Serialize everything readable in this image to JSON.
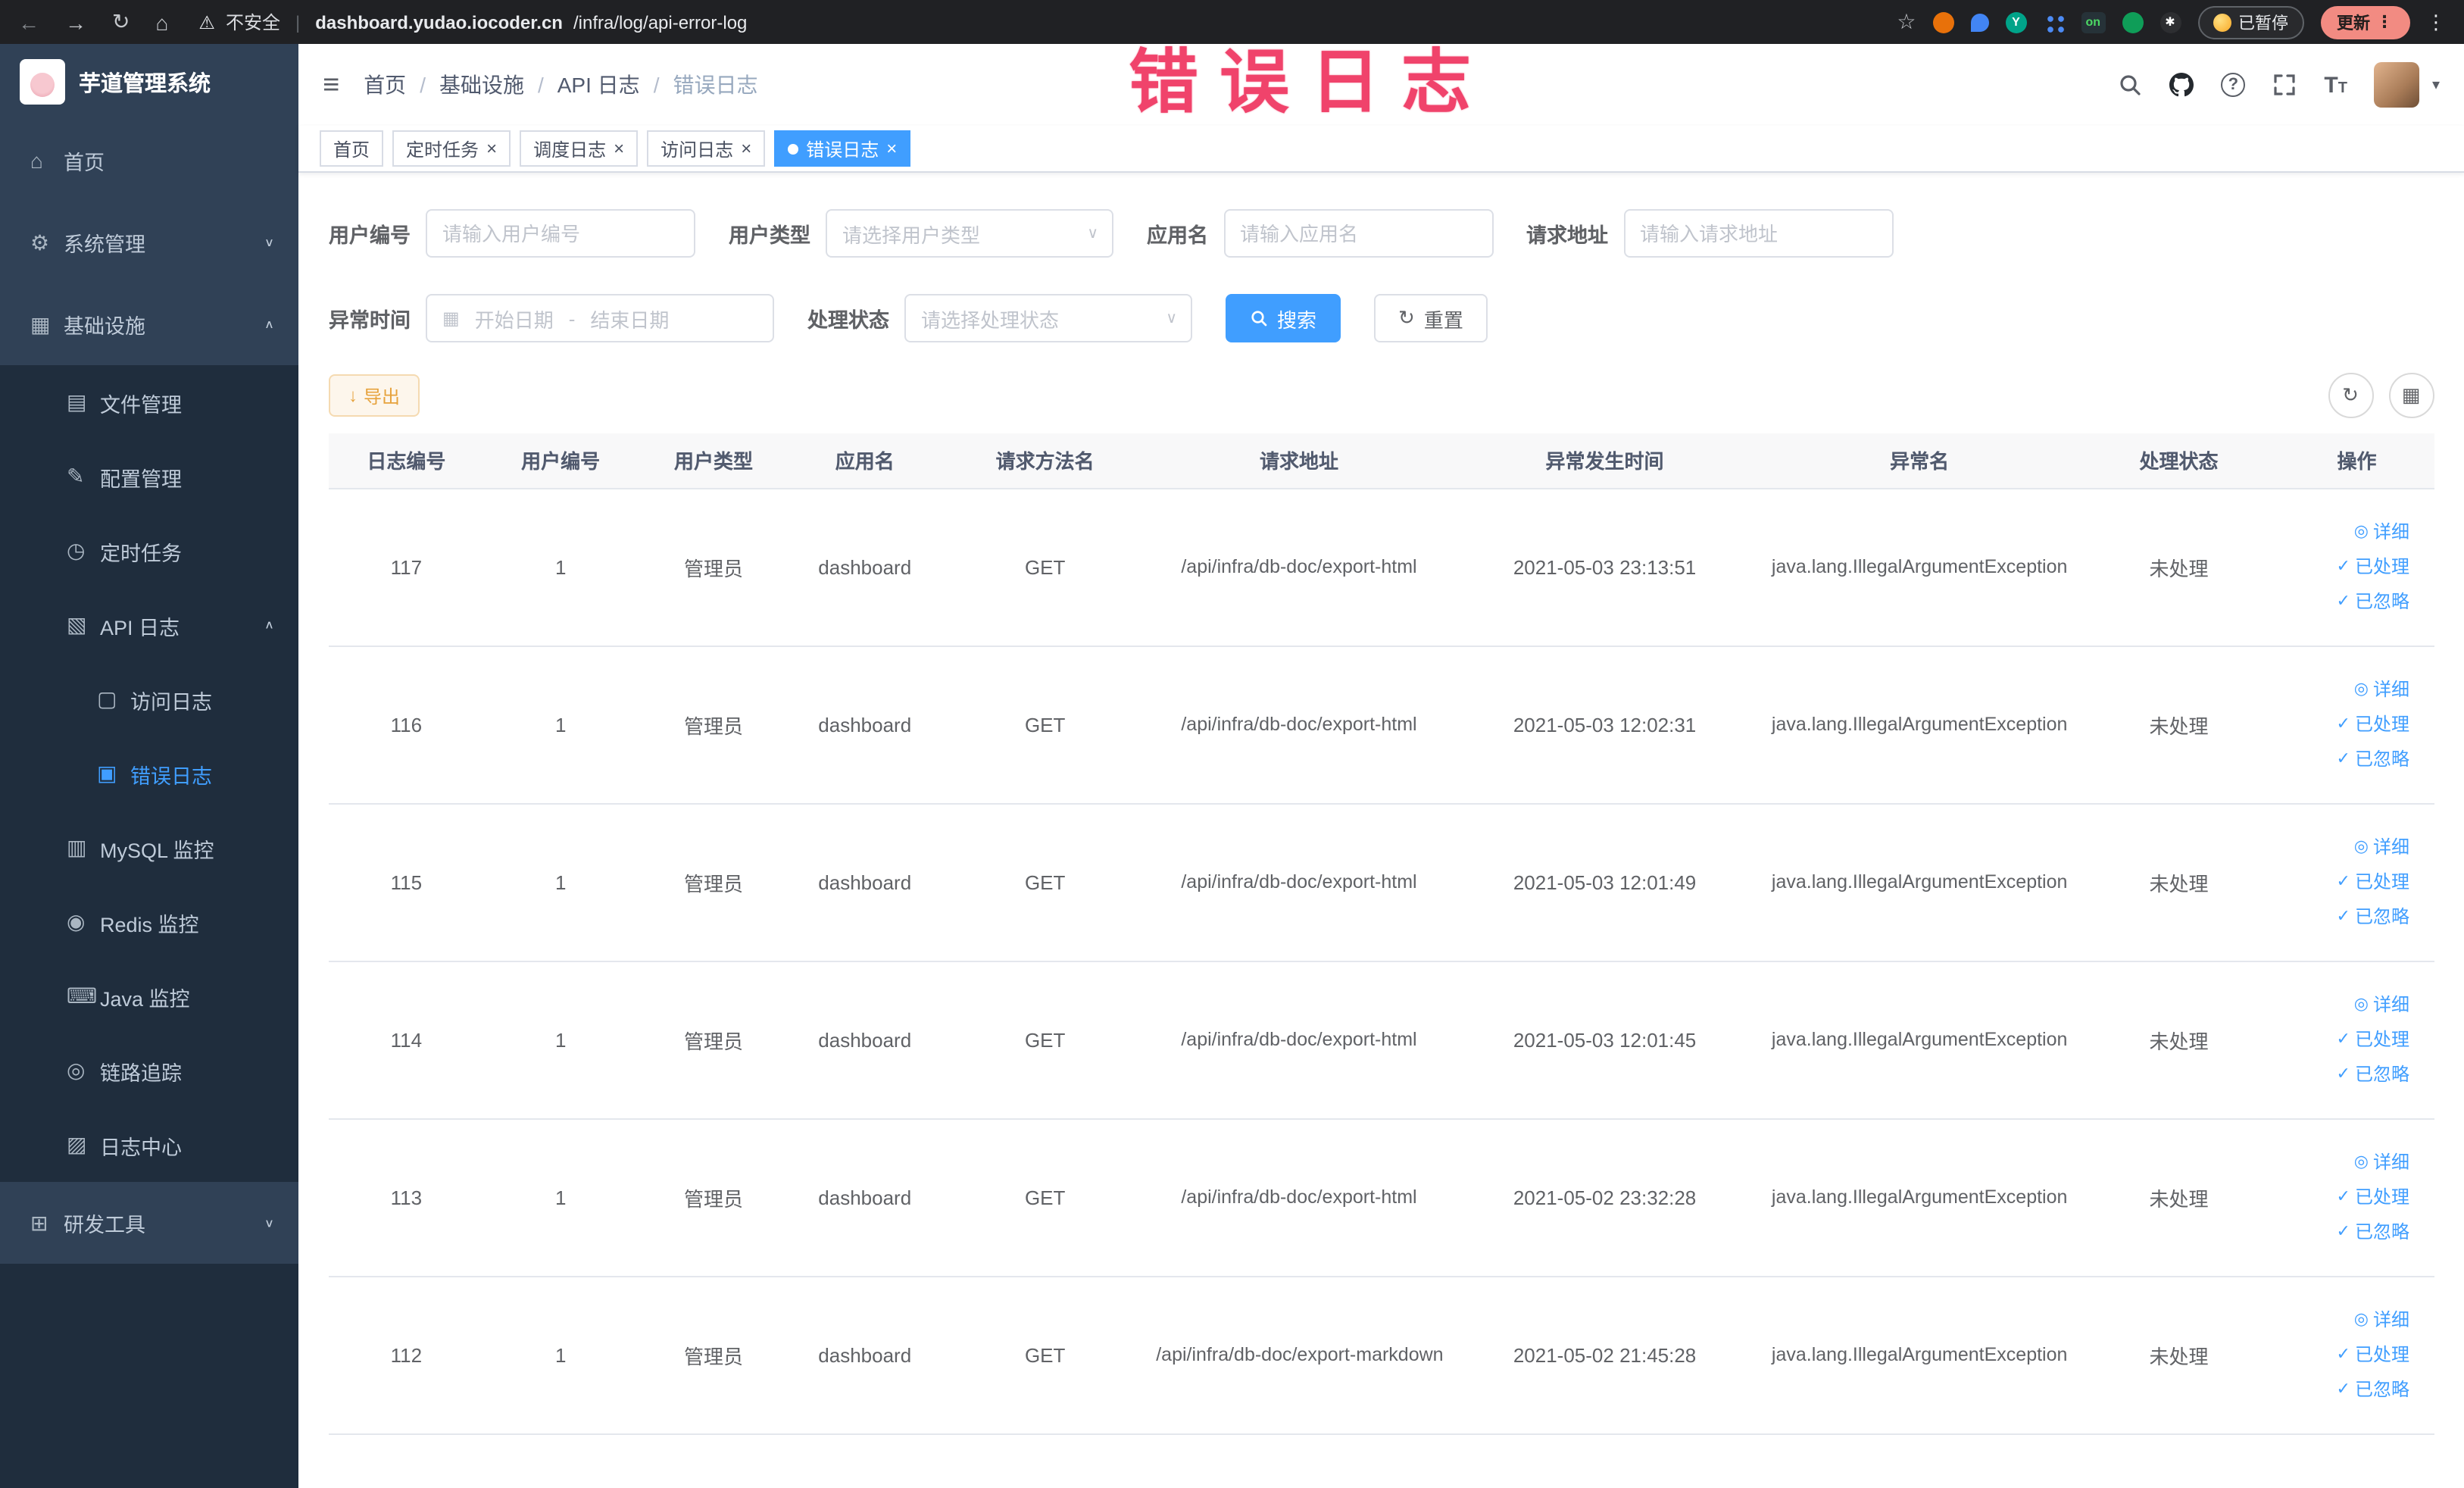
{
  "browser": {
    "security_label": "不安全",
    "url_domain": "dashboard.yudao.iocoder.cn",
    "url_path": "/infra/log/api-error-log",
    "paused_label": "已暂停",
    "update_label": "更新",
    "ext_on_label": "on",
    "ext_yudao_label": "Y"
  },
  "annotation": {
    "title": "错误日志",
    "color": "#f0436b"
  },
  "icons": {
    "back": "←",
    "forward": "→",
    "reload": "↻",
    "home": "⌂",
    "warning": "⚠",
    "star": "☆",
    "dots": "⋮",
    "hamburger": "≡",
    "caret_down": "▾",
    "chevron_up": "∧",
    "chevron_down": "∨",
    "calendar": "▦",
    "download": "↓",
    "refresh": "↻",
    "columns": "▦",
    "eye": "◎",
    "check": "✓",
    "close": "×",
    "active_dot": "●",
    "question": "?",
    "font_size": "T",
    "paw": "✱"
  },
  "sidebar": {
    "logo_title": "芋道管理系统",
    "menu": [
      {
        "label": "首页",
        "icon": "home-icon",
        "glyph": "⌂",
        "level": 0
      },
      {
        "label": "系统管理",
        "icon": "gear-icon",
        "glyph": "⚙",
        "level": 0,
        "chevron": "down"
      },
      {
        "label": "基础设施",
        "icon": "infra-icon",
        "glyph": "▦",
        "level": 0,
        "chevron": "up",
        "expanded": true
      },
      {
        "label": "文件管理",
        "icon": "file-icon",
        "glyph": "▤",
        "level": 1
      },
      {
        "label": "配置管理",
        "icon": "config-icon",
        "glyph": "✎",
        "level": 1
      },
      {
        "label": "定时任务",
        "icon": "timer-icon",
        "glyph": "◷",
        "level": 1
      },
      {
        "label": "API 日志",
        "icon": "api-log-icon",
        "glyph": "▧",
        "level": 1,
        "chevron": "up",
        "expanded": true
      },
      {
        "label": "访问日志",
        "icon": "access-log-icon",
        "glyph": "▢",
        "level": 2
      },
      {
        "label": "错误日志",
        "icon": "error-log-icon",
        "glyph": "▣",
        "level": 2,
        "active": true
      },
      {
        "label": "MySQL 监控",
        "icon": "mysql-icon",
        "glyph": "▥",
        "level": 1
      },
      {
        "label": "Redis 监控",
        "icon": "redis-icon",
        "glyph": "◉",
        "level": 1
      },
      {
        "label": "Java 监控",
        "icon": "java-icon",
        "glyph": "⌨",
        "level": 1
      },
      {
        "label": "链路追踪",
        "icon": "trace-icon",
        "glyph": "◎",
        "level": 1
      },
      {
        "label": "日志中心",
        "icon": "log-center-icon",
        "glyph": "▨",
        "level": 1
      },
      {
        "label": "研发工具",
        "icon": "tools-icon",
        "glyph": "⊞",
        "level": 0,
        "chevron": "down"
      }
    ]
  },
  "header": {
    "breadcrumb": [
      "首页",
      "基础设施",
      "API 日志",
      "错误日志"
    ],
    "separator": "/"
  },
  "tabs": [
    {
      "label": "首页"
    },
    {
      "label": "定时任务",
      "closable": true
    },
    {
      "label": "调度日志",
      "closable": true
    },
    {
      "label": "访问日志",
      "closable": true
    },
    {
      "label": "错误日志",
      "closable": true,
      "active": true
    }
  ],
  "filters": {
    "user_id": {
      "label": "用户编号",
      "placeholder": "请输入用户编号"
    },
    "user_type": {
      "label": "用户类型",
      "placeholder": "请选择用户类型"
    },
    "app_name": {
      "label": "应用名",
      "placeholder": "请输入应用名"
    },
    "request_url": {
      "label": "请求地址",
      "placeholder": "请输入请求地址"
    },
    "exception_time": {
      "label": "异常时间",
      "start_placeholder": "开始日期",
      "separator": "-",
      "end_placeholder": "结束日期"
    },
    "process_status": {
      "label": "处理状态",
      "placeholder": "请选择处理状态"
    },
    "search_label": "搜索",
    "reset_label": "重置"
  },
  "toolbar": {
    "export_label": "导出"
  },
  "table": {
    "columns": [
      "日志编号",
      "用户编号",
      "用户类型",
      "应用名",
      "请求方法名",
      "请求地址",
      "异常发生时间",
      "异常名",
      "处理状态",
      "操作"
    ],
    "actions": {
      "detail": "详细",
      "processed": "已处理",
      "ignored": "已忽略"
    },
    "rows": [
      {
        "log_id": "117",
        "user_id": "1",
        "user_type": "管理员",
        "app_name": "dashboard",
        "method": "GET",
        "url": "/api/infra/db-doc/export-html",
        "time": "2021-05-03 23:13:51",
        "exception": "java.lang.IllegalArgumentException",
        "status": "未处理"
      },
      {
        "log_id": "116",
        "user_id": "1",
        "user_type": "管理员",
        "app_name": "dashboard",
        "method": "GET",
        "url": "/api/infra/db-doc/export-html",
        "time": "2021-05-03 12:02:31",
        "exception": "java.lang.IllegalArgumentException",
        "status": "未处理"
      },
      {
        "log_id": "115",
        "user_id": "1",
        "user_type": "管理员",
        "app_name": "dashboard",
        "method": "GET",
        "url": "/api/infra/db-doc/export-html",
        "time": "2021-05-03 12:01:49",
        "exception": "java.lang.IllegalArgumentException",
        "status": "未处理"
      },
      {
        "log_id": "114",
        "user_id": "1",
        "user_type": "管理员",
        "app_name": "dashboard",
        "method": "GET",
        "url": "/api/infra/db-doc/export-html",
        "time": "2021-05-03 12:01:45",
        "exception": "java.lang.IllegalArgumentException",
        "status": "未处理"
      },
      {
        "log_id": "113",
        "user_id": "1",
        "user_type": "管理员",
        "app_name": "dashboard",
        "method": "GET",
        "url": "/api/infra/db-doc/export-html",
        "time": "2021-05-02 23:32:28",
        "exception": "java.lang.IllegalArgumentException",
        "status": "未处理"
      },
      {
        "log_id": "112",
        "user_id": "1",
        "user_type": "管理员",
        "app_name": "dashboard",
        "method": "GET",
        "url": "/api/infra/db-doc/export-markdown",
        "time": "2021-05-02 21:45:28",
        "exception": "java.lang.IllegalArgumentException",
        "status": "未处理"
      }
    ]
  }
}
